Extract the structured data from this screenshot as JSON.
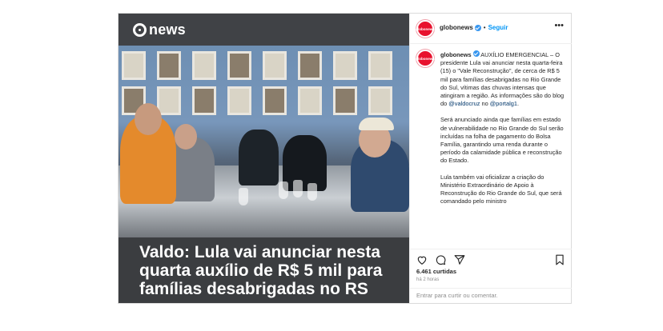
{
  "media": {
    "brand": "news",
    "headline": "Valdo: Lula vai anunciar nesta quarta auxílio de R$ 5 mil para famílias desabrigadas no RS"
  },
  "header": {
    "username": "globonews",
    "separator": "•",
    "follow": "Seguir",
    "avatar_text": "globonews",
    "more": "•••"
  },
  "caption": {
    "username": "globonews",
    "intro": " AUXÍLIO EMERGENCIAL – O presidente Lula vai anunciar nesta quarta-feira (15) o \"Vale Reconstrução\", de cerca de R$ 5 mil para famílias desabrigadas no Rio Grande do Sul, vítimas das chuvas intensas que atingiram a região. As informações são do blog do ",
    "mention1": "@valdocruz",
    "connector": " no ",
    "mention2": "@portalg1",
    "end": ".",
    "paragraph2": "Será anunciado ainda que famílias em estado de vulnerabilidade no Rio Grande do Sul serão incluídas na folha de pagamento do Bolsa Família, garantindo uma renda durante o período da calamidade pública e reconstrução do Estado.",
    "paragraph3": "Lula também vai oficializar a criação do Ministério Extraordinário de Apoio à Reconstrução do Rio Grande do Sul, que será comandado pelo ministro"
  },
  "actions": {
    "likes": "6.461 curtidas",
    "time": "há 2 horas"
  },
  "comment": {
    "placeholder": "Entrar para curtir ou comentar."
  },
  "colors": {
    "follow": "#0095f6",
    "verified": "#3897f0",
    "brand_red": "#e8112d"
  }
}
